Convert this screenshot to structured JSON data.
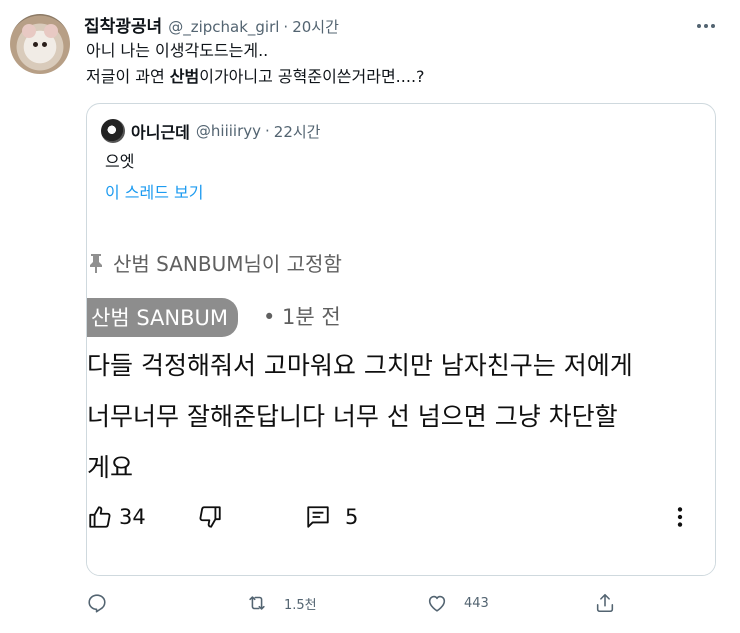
{
  "tweet": {
    "author_name": "집착광공녀",
    "author_handle": "@_zipchak_girl",
    "separator": "·",
    "time": "20시간",
    "line1": "아니 나는 이생각도드는게..",
    "line2_pre": "저글이 과연 ",
    "line2_bold": "산범",
    "line2_post": "이가아니고 공혁준이쓴거라면....?"
  },
  "quoted": {
    "author_name": "아니근데",
    "author_handle": "@hiiiiryy",
    "separator": "·",
    "time": "22시간",
    "text": "으엣",
    "thread_link": "이 스레드 보기"
  },
  "youtube_capture": {
    "pinned_text": "산범 SANBUM님이 고정함",
    "author_chip": "산범 SANBUM",
    "time": "• 1분 전",
    "comment_lines": [
      "다들 걱정해줘서 고마워요 그치만 남자친구는 저에게",
      "너무너무 잘해준답니다 너무 선 넘으면 그냥 차단할",
      "게요"
    ],
    "like_count": "34",
    "reply_count": "5"
  },
  "actions": {
    "reply_count": "",
    "retweet_count": "1.5천",
    "like_count": "443"
  },
  "icons": {
    "more": "more-horizontal-icon",
    "reply": "reply-icon",
    "retweet": "retweet-icon",
    "like": "heart-icon",
    "share": "share-icon"
  },
  "colors": {
    "link": "#1d9bf0",
    "secondary": "#536471",
    "border": "#cfd9de"
  }
}
